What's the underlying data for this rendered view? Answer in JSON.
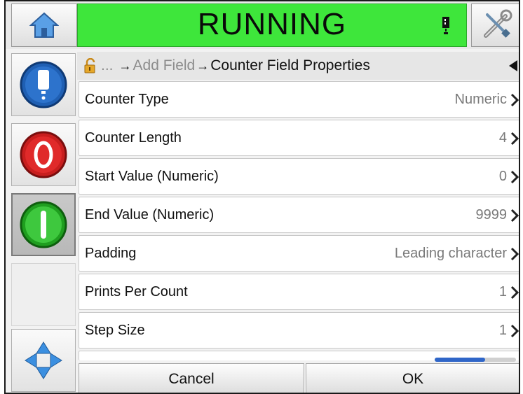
{
  "status": {
    "text": "RUNNING",
    "color": "#3ee63b"
  },
  "icons": {
    "home": "home-icon",
    "tools": "tools-icon",
    "printhead": "printhead-icon",
    "stop": "stop-icon",
    "start": "start-icon",
    "navigate": "navigation-arrows-icon",
    "lock": "padlock-icon",
    "back": "back-arrow-icon",
    "chevron": "chevron-right-icon"
  },
  "breadcrumb": {
    "ellipsis": "...",
    "sep1": "→",
    "parent": "Add Field",
    "sep2": "→",
    "current": "Counter Field Properties"
  },
  "properties": [
    {
      "label": "Counter Type",
      "value": "Numeric"
    },
    {
      "label": "Counter Length",
      "value": "4"
    },
    {
      "label": "Start Value (Numeric)",
      "value": "0"
    },
    {
      "label": "End Value (Numeric)",
      "value": "9999"
    },
    {
      "label": "Padding",
      "value": "Leading character"
    },
    {
      "label": "Prints Per Count",
      "value": "1"
    },
    {
      "label": "Step Size",
      "value": "1"
    }
  ],
  "scroll": {
    "position_fraction": 0.62
  },
  "buttons": {
    "cancel": "Cancel",
    "ok": "OK"
  }
}
